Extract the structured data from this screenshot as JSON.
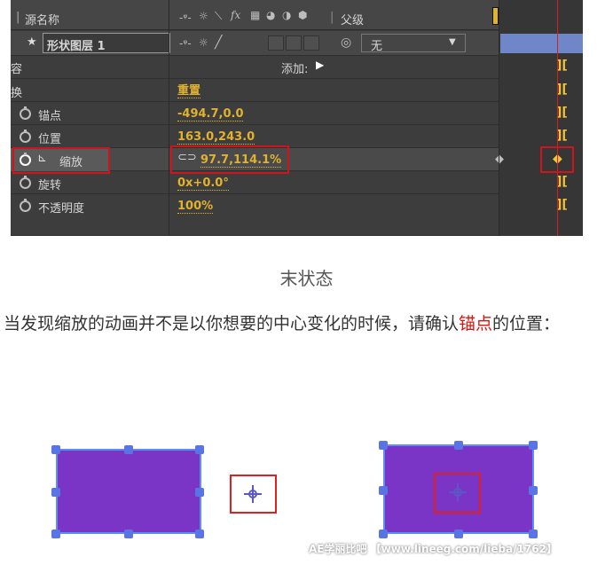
{
  "panel": {
    "header": {
      "source_name": "源名称",
      "switch_icons": [
        "shy-icon",
        "sun-icon",
        "slash-icon",
        "fx-icon",
        "film-icon",
        "motion-blur-icon",
        "adjust-icon",
        "cube-icon"
      ],
      "parent_label": "父级"
    },
    "layer": {
      "name": "形状图层 1",
      "parent_value": "无"
    },
    "rows": [
      {
        "label": "容",
        "value": "",
        "add_label": "添加:"
      },
      {
        "label": "换",
        "value": "重置"
      },
      {
        "label": "锚点",
        "value": "-494.7,0.0"
      },
      {
        "label": "位置",
        "value": "163.0,243.0"
      },
      {
        "label": "缩放",
        "value": "97.7,114.1%"
      },
      {
        "label": "旋转",
        "value": "0x+0.0°"
      },
      {
        "label": "不透明度",
        "value": "100%"
      }
    ],
    "colors": {
      "panel_bg": "#3b3b3b",
      "value_color": "#e1b22e",
      "highlight_box": "#d0141c",
      "playhead": "#d42020"
    }
  },
  "caption": "末状态",
  "body": {
    "before": "当发现缩放的动画并不是以你想要的中心变化的时候，请确认",
    "highlight": "锚点",
    "after": "的位置："
  },
  "watermark": "AE学丽比吧 【www.lineeg.com/lieba/1762】",
  "illustration": {
    "shape_color": "#7a35c7",
    "handle_color": "#5b74e4",
    "anchor_icon": "crosshair-anchor-icon"
  }
}
